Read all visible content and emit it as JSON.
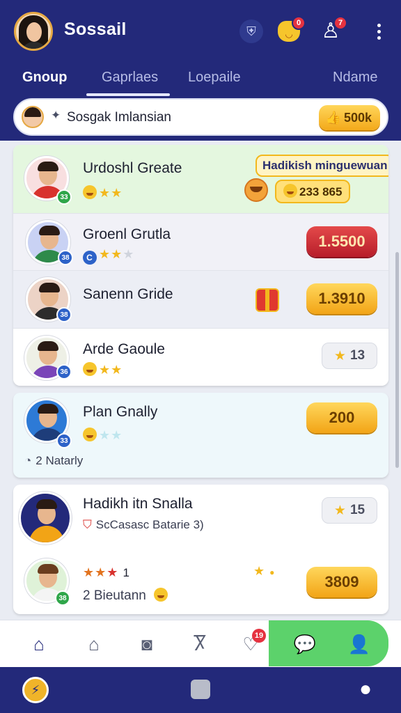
{
  "app": {
    "title": "Sossail",
    "notification_badge": "0",
    "people_badge": "7"
  },
  "tabs": [
    {
      "label": "Gnoup",
      "active": true
    },
    {
      "label": "Gaprlaes",
      "active": false
    },
    {
      "label": "Loepaile",
      "active": false
    },
    {
      "label": "Ndame",
      "active": false
    }
  ],
  "search": {
    "text": "Sosgak Imlansian",
    "coins": "500k"
  },
  "rows": [
    {
      "name": "Urdoshl Greate",
      "level": "33",
      "stars_on": 2,
      "stars_total": 3,
      "promo_title": "Hadikish minguewuan",
      "promo_sub": "233 865"
    },
    {
      "name": "Groenl Grutla",
      "level": "38",
      "stars_on": 2,
      "stars_total": 3,
      "value": "1.5500"
    },
    {
      "name": "Sanenn Gride",
      "level": "38",
      "value": "1.3910"
    },
    {
      "name": "Arde Gaoule",
      "level": "36",
      "stars_on": 2,
      "stars_total": 3,
      "value": "13"
    },
    {
      "name": "Plan Gnally",
      "level": "33",
      "stars_on": 0,
      "stars_total": 2,
      "value": "200",
      "sub": "2 Natarly"
    },
    {
      "name": "Hadikh itn Snalla",
      "value": "15",
      "sub": "ScCasasc Batarie 3)"
    },
    {
      "name": "",
      "level": "38",
      "stars_text": "1",
      "value": "3809",
      "sub": "2 Bieutann"
    }
  ],
  "nav": {
    "notify_badge": "19"
  },
  "icons": {
    "shield": "shield-icon",
    "crown": "crown-face-icon",
    "people": "people-icon",
    "more": "more-vertical-icon",
    "home": "home-icon",
    "store": "store-icon",
    "camera": "camera-icon",
    "friends": "friends-icon",
    "notify": "notification-icon",
    "chat": "chat-icon",
    "profile": "profile-icon"
  },
  "colors": {
    "header": "#23297a",
    "accent_green": "#5cd26b",
    "gold": "#f2a416",
    "red": "#b81d2a"
  }
}
